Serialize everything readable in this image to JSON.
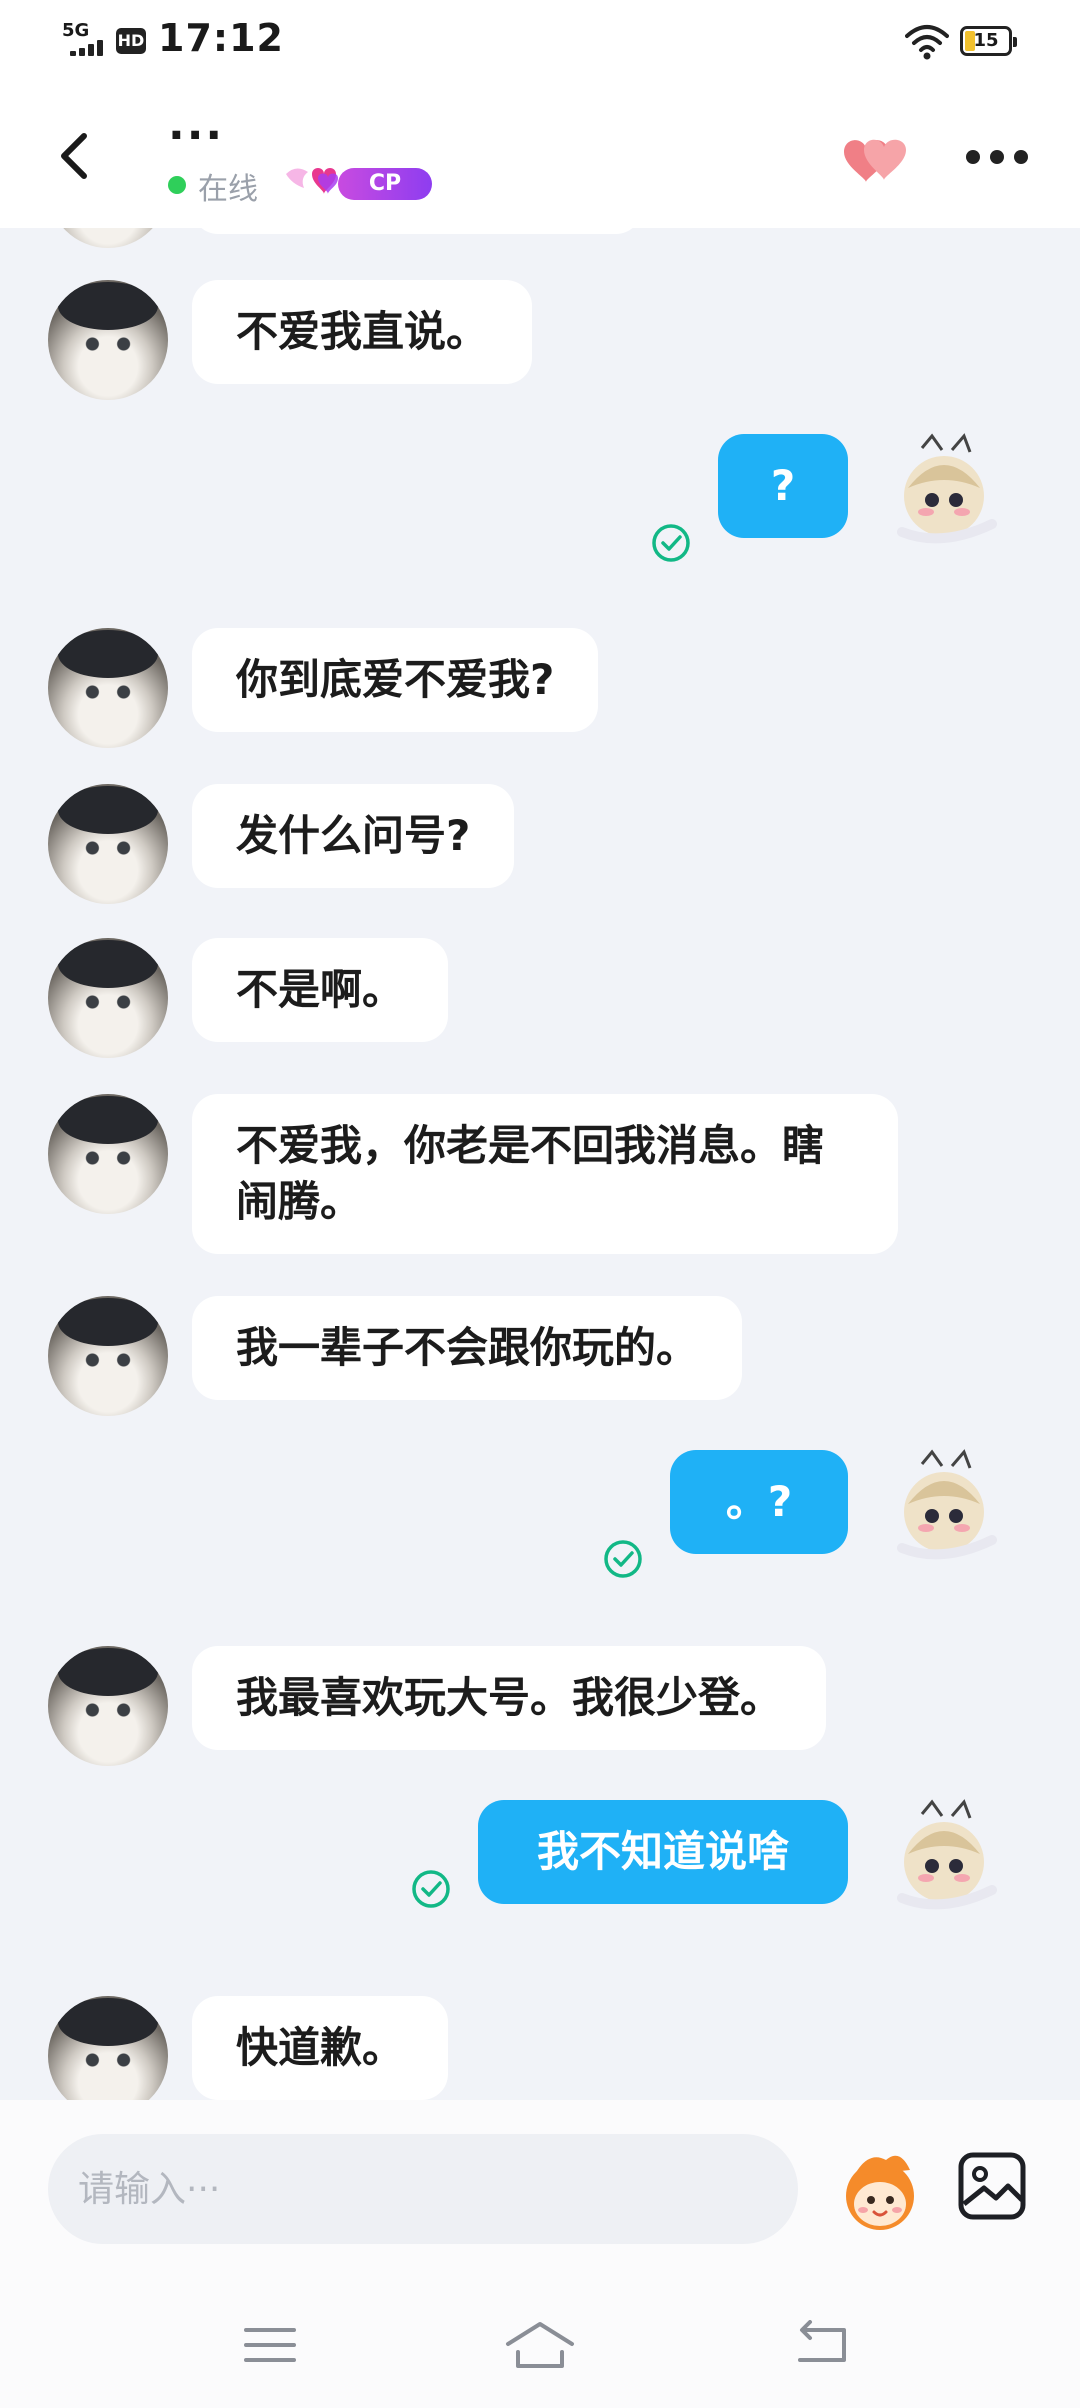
{
  "status_bar": {
    "network": "5G",
    "hd": "HD",
    "time": "17:12",
    "battery": "15"
  },
  "header": {
    "title": "···",
    "status": "在线",
    "badge": "CP",
    "icons": {
      "back": "chevron-left-icon",
      "intimacy": "double-heart-icon",
      "more": "more-horizontal-icon"
    }
  },
  "chat": {
    "messages": [
      {
        "side": "received",
        "text": "不爱我直说。"
      },
      {
        "side": "sent",
        "text": "?",
        "read": true
      },
      {
        "side": "received",
        "text": "你到底爱不爱我?"
      },
      {
        "side": "received",
        "text": "发什么问号?"
      },
      {
        "side": "received",
        "text": "不是啊。"
      },
      {
        "side": "received",
        "text": "不爱我，你老是不回我消息。瞎闹腾。"
      },
      {
        "side": "received",
        "text": "我一辈子不会跟你玩的。"
      },
      {
        "side": "sent",
        "text": "。?",
        "read": true
      },
      {
        "side": "received",
        "text": "我最喜欢玩大号。我很少登。"
      },
      {
        "side": "sent",
        "text": "我不知道说啥",
        "read": true
      },
      {
        "side": "received",
        "text": "快道歉。"
      }
    ]
  },
  "input": {
    "placeholder": "请输入···",
    "value": ""
  },
  "colors": {
    "sent_bubble": "#1fb1f6",
    "received_bubble": "#ffffff",
    "background": "#f1f3f8",
    "read_check": "#12b886",
    "online": "#2fcf5a",
    "cp_badge": "#b048e8"
  }
}
